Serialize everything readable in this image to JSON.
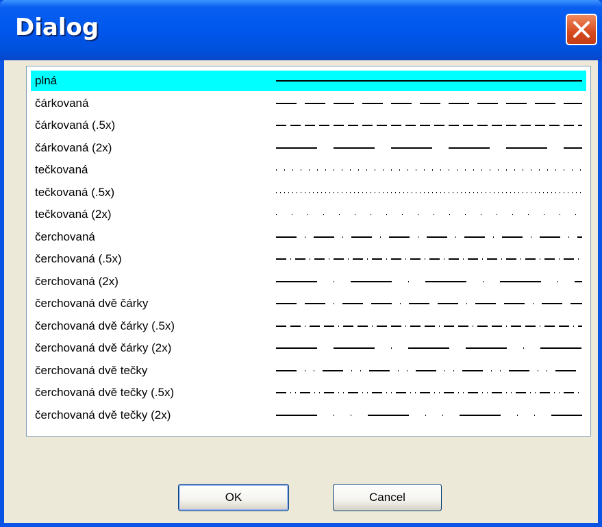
{
  "window": {
    "title": "Dialog",
    "close_icon": "close-icon"
  },
  "list": {
    "items": [
      {
        "label": "plná",
        "pattern": "solid",
        "selected": true
      },
      {
        "label": "čárkovaná",
        "pattern": "dashed"
      },
      {
        "label": "čárkovaná (.5x)",
        "pattern": "dashed-half"
      },
      {
        "label": "čárkovaná (2x)",
        "pattern": "dashed-double"
      },
      {
        "label": "tečkovaná",
        "pattern": "dotted"
      },
      {
        "label": "tečkovaná (.5x)",
        "pattern": "dotted-half"
      },
      {
        "label": "tečkovaná (2x)",
        "pattern": "dotted-double"
      },
      {
        "label": "čerchovaná",
        "pattern": "dash-dot"
      },
      {
        "label": "čerchovaná (.5x)",
        "pattern": "dash-dot-half"
      },
      {
        "label": "čerchovaná (2x)",
        "pattern": "dash-dot-double"
      },
      {
        "label": "čerchovaná dvě čárky",
        "pattern": "dash-dash-dot"
      },
      {
        "label": "čerchovaná dvě čárky (.5x)",
        "pattern": "dash-dash-dot-half"
      },
      {
        "label": "čerchovaná dvě čárky (2x)",
        "pattern": "dash-dash-dot-double"
      },
      {
        "label": "čerchovaná dvě tečky",
        "pattern": "dash-dot-dot"
      },
      {
        "label": "čerchovaná dvě tečky (.5x)",
        "pattern": "dash-dot-dot-half"
      },
      {
        "label": "čerchovaná dvě tečky (2x)",
        "pattern": "dash-dot-dot-double"
      }
    ],
    "selected_color": "#00ffff"
  },
  "buttons": {
    "ok": "OK",
    "cancel": "Cancel"
  }
}
